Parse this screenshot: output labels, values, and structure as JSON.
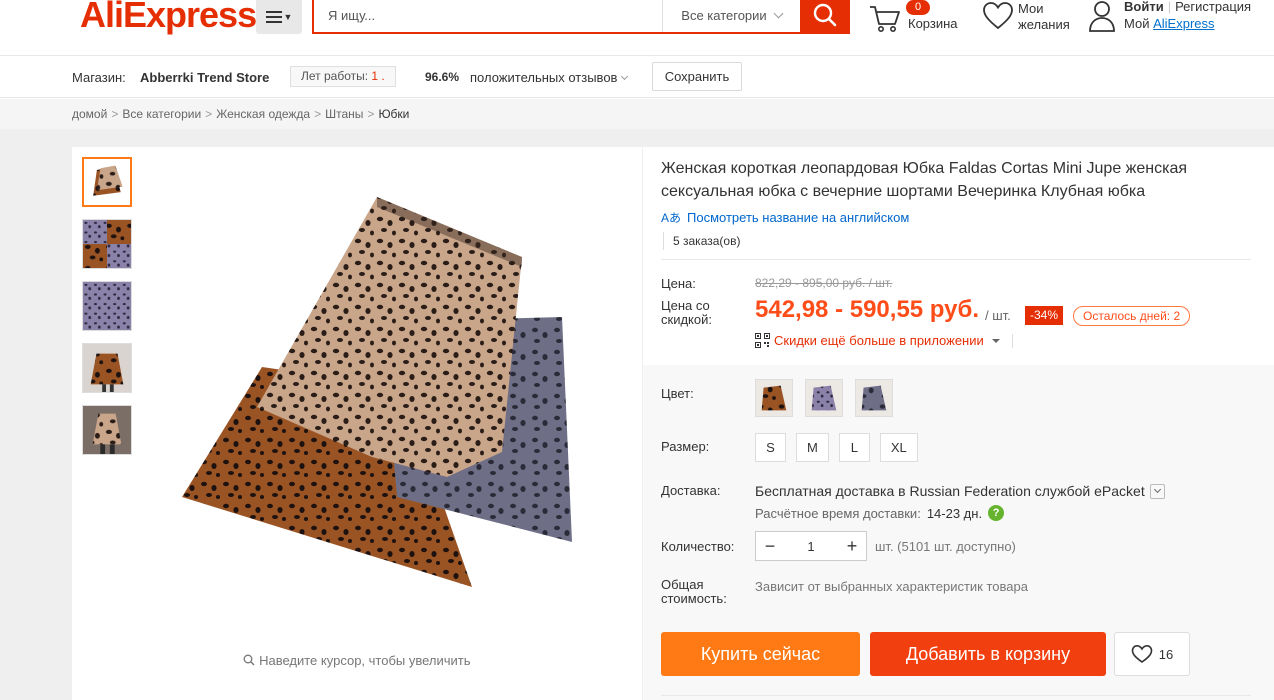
{
  "header": {
    "logo": "AliExpress",
    "logo_mark": "®",
    "search_placeholder": "Я ищу...",
    "search_category": "Все категории",
    "cart_count": "0",
    "cart_label": "Корзина",
    "wishlist_line1": "Мои",
    "wishlist_line2": "желания",
    "login": "Войти",
    "register": "Регистрация",
    "my_prefix": "Мой",
    "my_link": "AliExpress"
  },
  "store": {
    "label": "Магазин:",
    "name": "Abberrki Trend Store",
    "years_label": "Лет работы:",
    "years_value": "1 .",
    "rating": "96.6%",
    "rating_text": "положительных отзывов",
    "save_label": "Сохранить"
  },
  "breadcrumb": [
    {
      "label": "домой"
    },
    {
      "label": "Все категории"
    },
    {
      "label": "Женская одежда"
    },
    {
      "label": "Штаны"
    },
    {
      "label": "Юбки"
    }
  ],
  "gallery": {
    "zoom_hint": "Наведите курсор, чтобы увеличить",
    "thumbnails": [
      "leopard-skirt-brown",
      "leopard-skirt-collage",
      "purple-leopard-fabric",
      "brown-leopard-skirt-model",
      "skirt-model-photo"
    ]
  },
  "product": {
    "title": "Женская короткая леопардовая Юбка Faldas Cortas Mini Jupe женская сексуальная юбка с вечерние шортами Вечеринка Клубная юбка",
    "translate_icon": "Aあ",
    "translate_link": "Посмотреть название на английском",
    "orders": "5 заказа(ов)",
    "price_label": "Цена:",
    "old_price": "822,29 - 895,00 руб. / шт.",
    "discount_price_label": "Цена со скидкой:",
    "new_price": "542,98 - 590,55 руб.",
    "unit": "/ шт.",
    "discount_pct": "-34%",
    "days_left": "Осталось дней: 2",
    "app_discount": "Скидки ещё больше в приложении"
  },
  "options": {
    "color_label": "Цвет:",
    "colors": [
      "brown",
      "purple",
      "dark-gray"
    ],
    "size_label": "Размер:",
    "sizes": [
      "S",
      "M",
      "L",
      "XL"
    ],
    "shipping_label": "Доставка:",
    "shipping_main": "Бесплатная доставка в Russian Federation службой ePacket",
    "shipping_time_label": "Расчётное время доставки:",
    "shipping_time_value": "14-23 дн.",
    "quantity_label": "Количество:",
    "quantity_value": "1",
    "quantity_available": "шт. (5101 шт. доступно)",
    "total_label": "Общая стоимость:",
    "total_value": "Зависит от выбранных характеристик товара"
  },
  "actions": {
    "buy_now": "Купить сейчас",
    "add_to_cart": "Добавить в корзину",
    "wish_count": "16"
  },
  "colors": {
    "brand": "#e62e04",
    "buy": "#ff7a14",
    "cart": "#f23f0f",
    "link": "#0066cc"
  }
}
